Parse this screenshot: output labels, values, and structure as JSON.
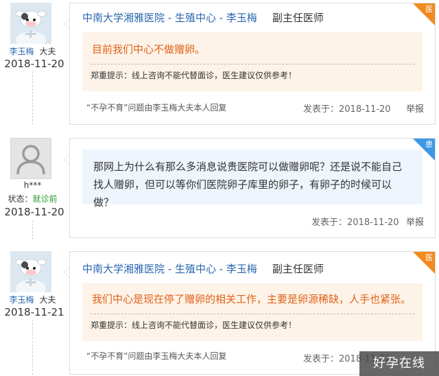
{
  "posts": [
    {
      "author_name": "李玉梅",
      "author_role": "大夫",
      "date": "2018-11-20",
      "hospital_line": "中南大学湘雅医院 - 生殖中心 - 李玉梅",
      "doctor_title": "副主任医师",
      "corner_label": "医",
      "answer": "目前我们中心不做赠卵。",
      "tip": "郑重提示：线上咨询不能代替面诊，医生建议仅供参考！",
      "source_note": "“不孕不育”问题由李玉梅大夫本人回复",
      "posted_at": "发表于：2018-11-20",
      "report": "举报"
    },
    {
      "author_name": "h***",
      "status_label": "状态：",
      "status_value": "就诊前",
      "date": "2018-11-20",
      "corner_label": "患",
      "question": "那网上为什么有那么多消息说贵医院可以做赠卵呢？还是说不能自己找人赠卵，但可以等你们医院卵子库里的卵子，有卵子的时候可以做？",
      "posted_at": "发表于：2018-11-20",
      "report": "举报"
    },
    {
      "author_name": "李玉梅",
      "author_role": "大夫",
      "date": "2018-11-21",
      "hospital_line": "中南大学湘雅医院 - 生殖中心 - 李玉梅",
      "doctor_title": "副主任医师",
      "corner_label": "医",
      "answer": "我们中心是现在停了赠卵的相关工作，主要是卵源稀缺，人手也紧张。",
      "tip": "郑重提示：线上咨询不能代替面诊，医生建议仅供参考！",
      "source_note": "“不孕不育”问题由李玉梅大夫本人回复",
      "posted_at": "发表于：2018-11-21",
      "report": "举报"
    }
  ],
  "watermark": "好孕在线",
  "colors": {
    "link_blue": "#2a67b0",
    "answer_orange": "#e0621a",
    "doctor_corner": "#f28a1f",
    "patient_corner": "#3c98e6",
    "status_green": "#2e9a2e"
  }
}
